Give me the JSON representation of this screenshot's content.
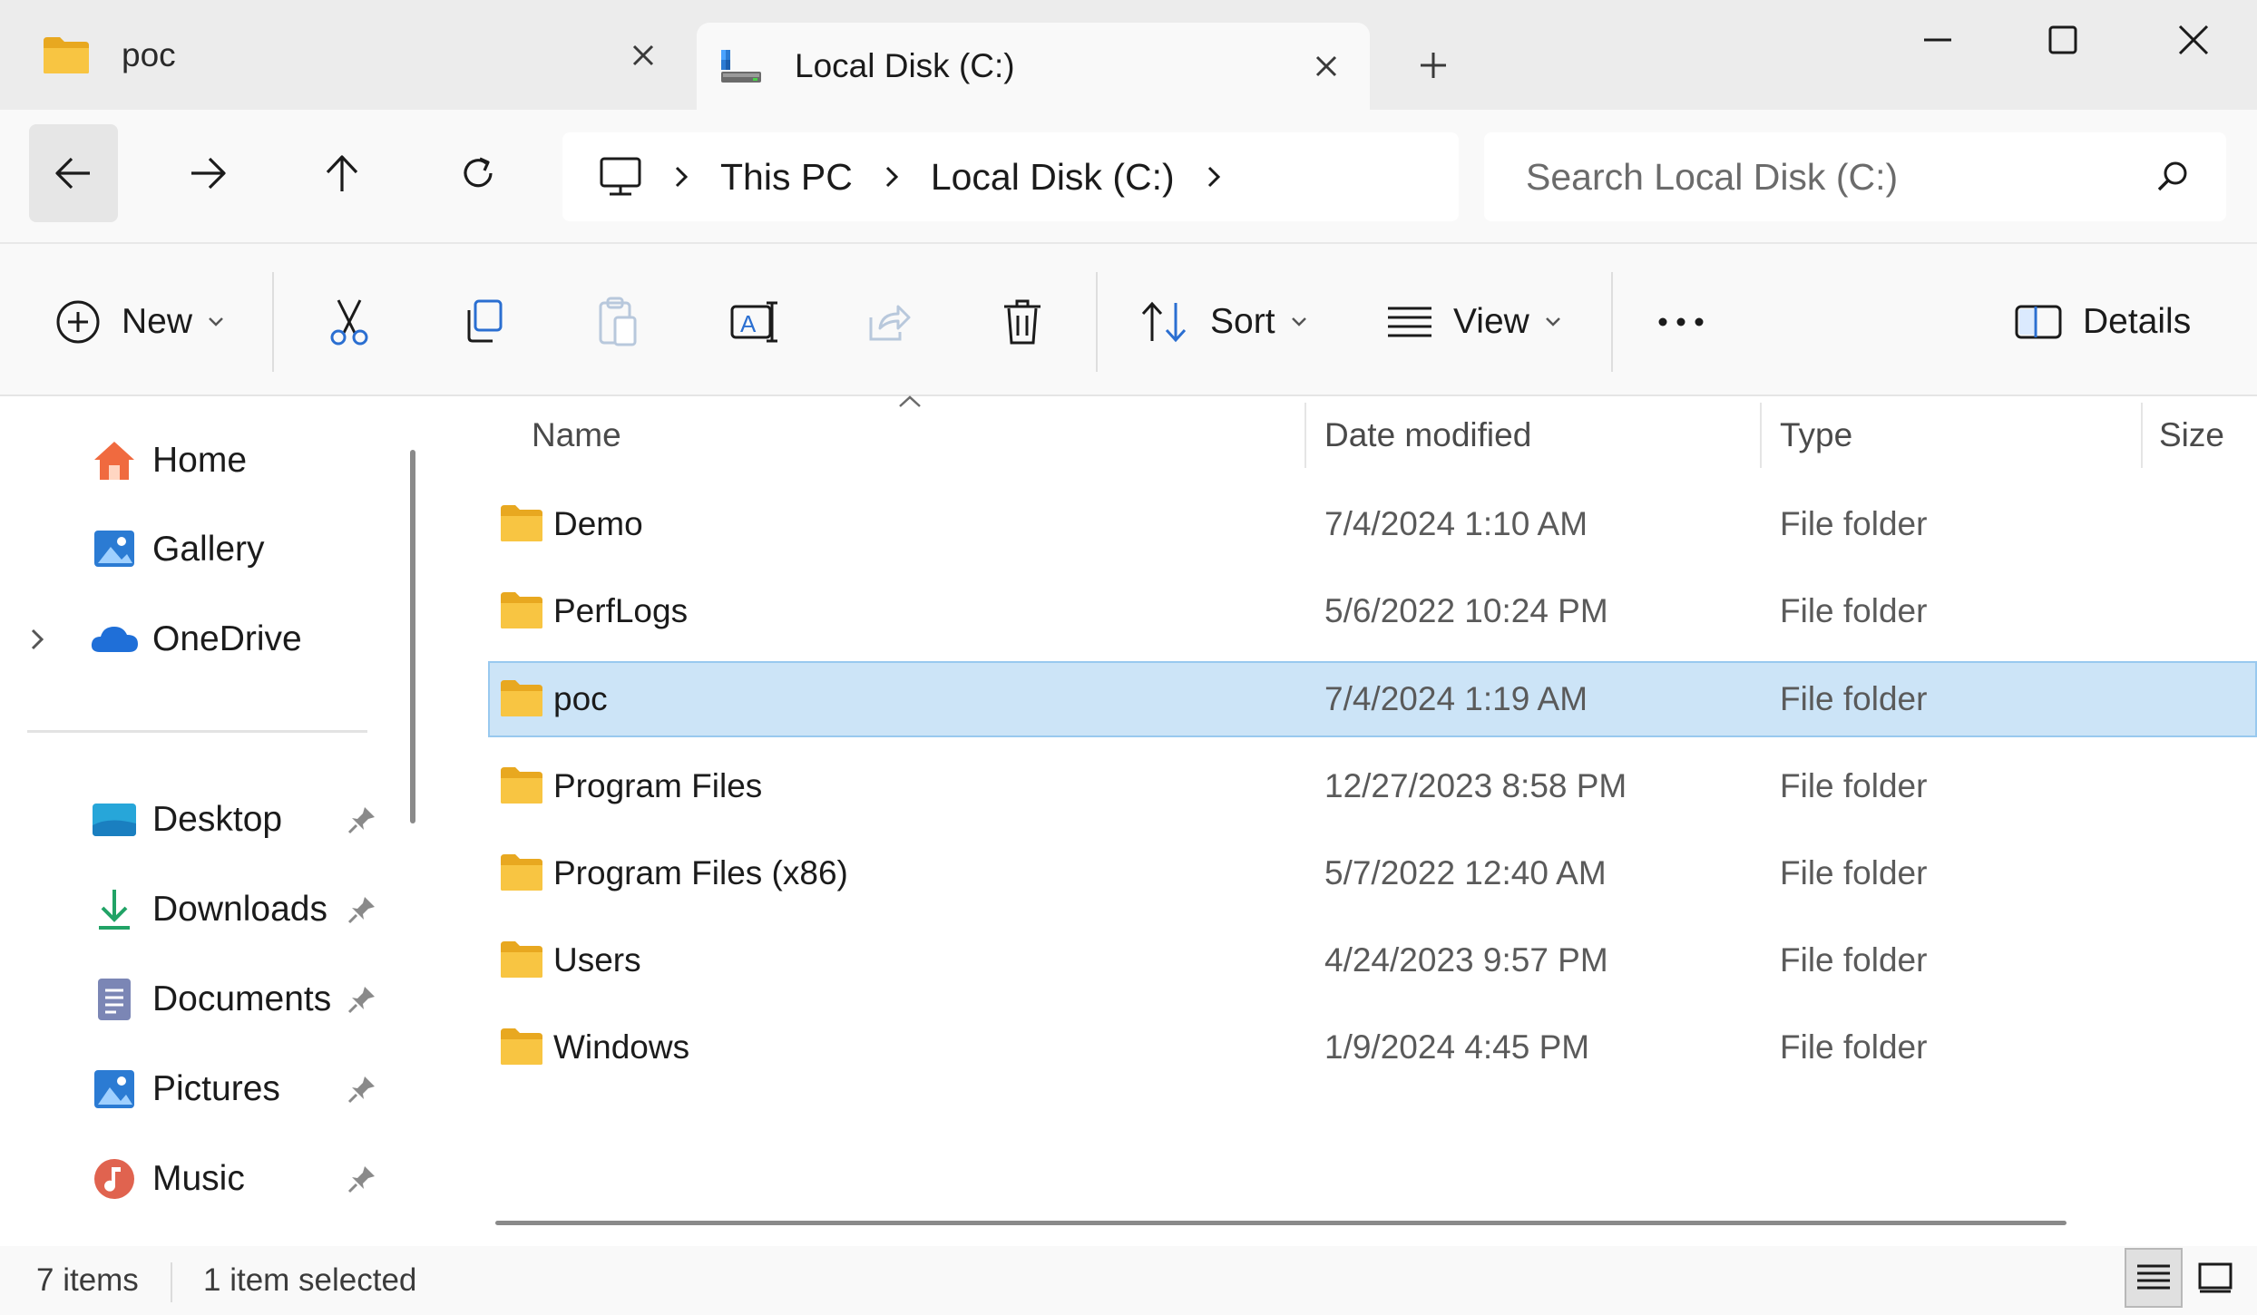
{
  "tabs": [
    {
      "label": "poc",
      "icon": "folder-icon",
      "active": false
    },
    {
      "label": "Local Disk (C:)",
      "icon": "drive-icon",
      "active": true
    }
  ],
  "window_controls": [
    "minimize",
    "maximize",
    "close"
  ],
  "breadcrumb": [
    "This PC",
    "Local Disk (C:)"
  ],
  "search": {
    "placeholder": "Search Local Disk (C:)"
  },
  "command_bar": {
    "new_label": "New",
    "sort_label": "Sort",
    "view_label": "View",
    "details_label": "Details"
  },
  "sidebar": {
    "top": [
      {
        "label": "Home",
        "icon": "home-icon"
      },
      {
        "label": "Gallery",
        "icon": "gallery-icon"
      },
      {
        "label": "OneDrive",
        "icon": "onedrive-icon",
        "expandable": true
      }
    ],
    "pinned": [
      {
        "label": "Desktop",
        "icon": "desktop-icon"
      },
      {
        "label": "Downloads",
        "icon": "downloads-icon"
      },
      {
        "label": "Documents",
        "icon": "documents-icon"
      },
      {
        "label": "Pictures",
        "icon": "pictures-icon"
      },
      {
        "label": "Music",
        "icon": "music-icon"
      }
    ]
  },
  "columns": {
    "name": "Name",
    "date": "Date modified",
    "type": "Type",
    "size": "Size"
  },
  "files": [
    {
      "name": "Demo",
      "date": "7/4/2024 1:10 AM",
      "type": "File folder",
      "selected": false
    },
    {
      "name": "PerfLogs",
      "date": "5/6/2022 10:24 PM",
      "type": "File folder",
      "selected": false
    },
    {
      "name": "poc",
      "date": "7/4/2024 1:19 AM",
      "type": "File folder",
      "selected": true
    },
    {
      "name": "Program Files",
      "date": "12/27/2023 8:58 PM",
      "type": "File folder",
      "selected": false
    },
    {
      "name": "Program Files (x86)",
      "date": "5/7/2022 12:40 AM",
      "type": "File folder",
      "selected": false
    },
    {
      "name": "Users",
      "date": "4/24/2023 9:57 PM",
      "type": "File folder",
      "selected": false
    },
    {
      "name": "Windows",
      "date": "1/9/2024 4:45 PM",
      "type": "File folder",
      "selected": false
    }
  ],
  "status": {
    "items": "7 items",
    "selection": "1 item selected"
  },
  "colors": {
    "accent": "#0067c0",
    "selection": "#cce4f7",
    "folder": "#f8c542"
  }
}
